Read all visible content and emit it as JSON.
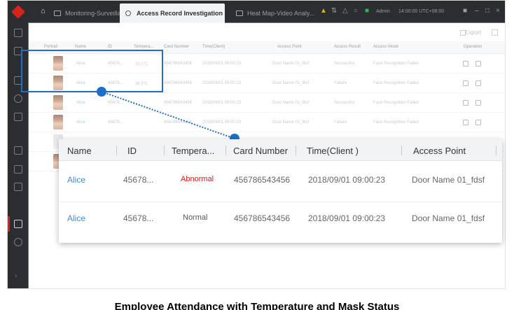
{
  "window": {
    "tabs": [
      {
        "label": "Monitoring-Surveillance",
        "active": false
      },
      {
        "label": "Access Record Investigation",
        "active": true
      },
      {
        "label": "Heat Map-Video Analy...",
        "active": false
      }
    ],
    "user": "Admin",
    "clock": "14:00:00 UTC+08:00"
  },
  "toolbar": {
    "export_label": "Export"
  },
  "table": {
    "columns": [
      "Portrait",
      "Name",
      "ID",
      "Tempera...",
      "Card Number",
      "Time(Client)",
      "Access Point",
      "Access Result",
      "Access Mode",
      "Operation"
    ],
    "rows": [
      {
        "name": "Alice",
        "id": "45678...",
        "temp": "38.1℃",
        "card": "456786543456",
        "time": "2018/09/01 09:00:23",
        "point": "Door Name 01_fdsf",
        "result": "Successful",
        "mode": "Face Recognition Failed"
      },
      {
        "name": "Alice",
        "id": "45678...",
        "temp": "36.5℃",
        "card": "456786543456",
        "time": "2018/09/01 09:00:23",
        "point": "Door Name 01_fdsf",
        "result": "Failure",
        "mode": "Face Recognition Failed"
      },
      {
        "name": "Alice",
        "id": "45678...",
        "temp": "",
        "card": "456786543456",
        "time": "2018/09/01 09:00:23",
        "point": "Door Name 01_fdsf",
        "result": "Successful",
        "mode": "Face Recognition Failed"
      },
      {
        "name": "Alice",
        "id": "45678...",
        "temp": "",
        "card": "456786543456",
        "time": "2018/09/01 09:00:23",
        "point": "Door Name 01_fdsf",
        "result": "Failure",
        "mode": "Face Recognition Failed"
      }
    ]
  },
  "zoom": {
    "columns": [
      "Name",
      "ID",
      "Tempera...",
      "Card Number",
      "Time(Client )",
      "Access Point"
    ],
    "rows": [
      {
        "name": "Alice",
        "id": "45678...",
        "temp": "Abnormal",
        "card": "456786543456",
        "time": "2018/09/01 09:00:23",
        "point": "Door Name 01_fdsf"
      },
      {
        "name": "Alice",
        "id": "45678...",
        "temp": "Normal",
        "card": "456786543456",
        "time": "2018/09/01 09:00:23",
        "point": "Door Name 01_fdsf"
      }
    ]
  },
  "colors": {
    "accent": "#1e6fc9",
    "abnormal": "#e0191a",
    "brand": "#d8231a",
    "link": "#3c8de0"
  },
  "caption": "Employee Attendance with Temperature and Mask Status"
}
